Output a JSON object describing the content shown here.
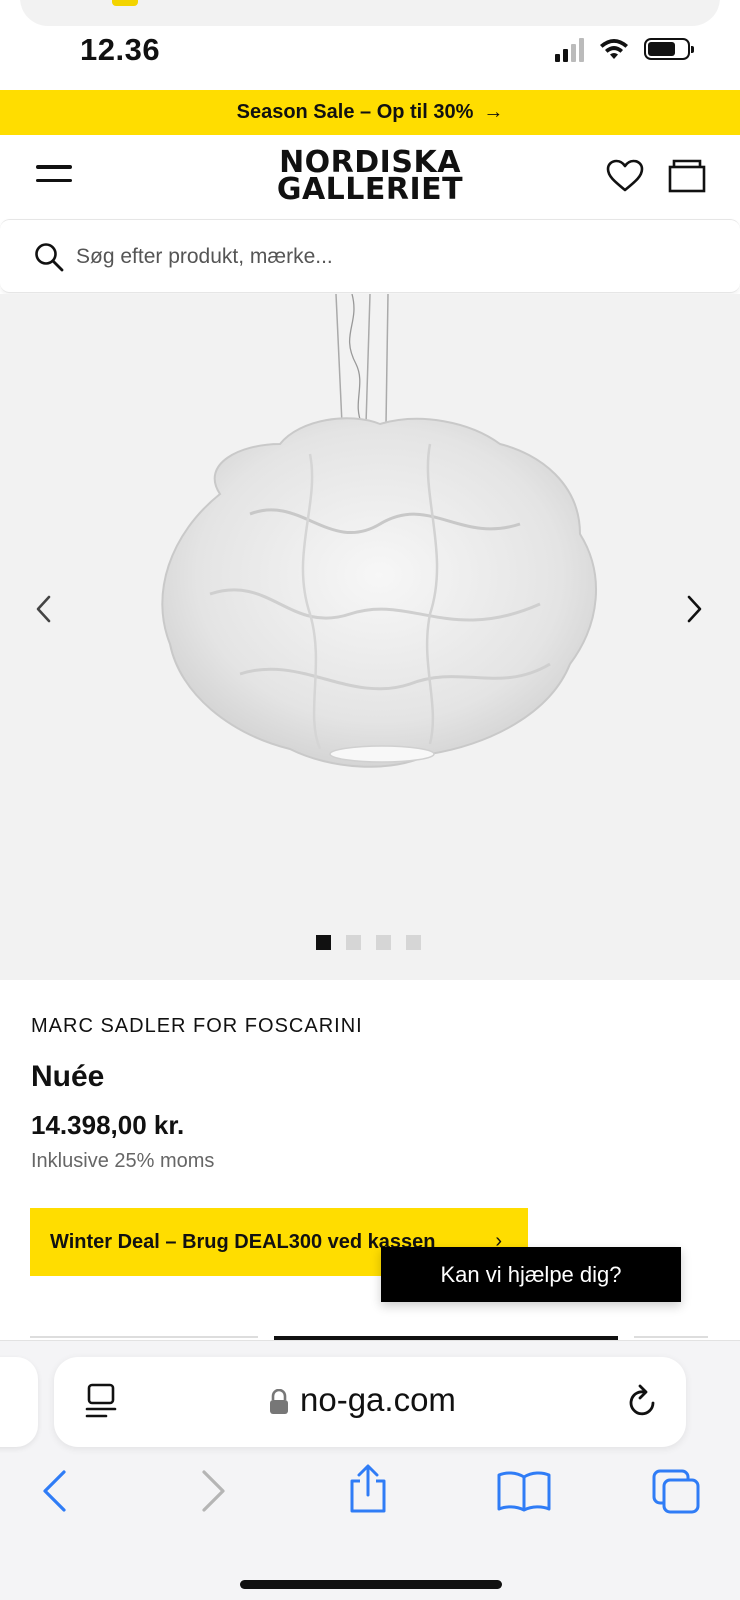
{
  "status_bar": {
    "time": "12.36"
  },
  "promo_bar": {
    "text": "Season Sale – Op til 30%",
    "arrow": "→"
  },
  "header": {
    "logo_line1": "NORDISKA",
    "logo_line2": "GALLERIET"
  },
  "search": {
    "placeholder": "Søg efter produkt, mærke..."
  },
  "gallery": {
    "image_count": 4,
    "active_index": 0
  },
  "product": {
    "brand": "MARC SADLER FOR FOSCARINI",
    "name": "Nuée",
    "price": "14.398,00 kr.",
    "vat_note": "Inklusive 25% moms"
  },
  "deal_banner": {
    "text": "Winter Deal – Brug DEAL300 ved kassen",
    "chevron": "›"
  },
  "chat_button": {
    "label": "Kan vi hjælpe dig?"
  },
  "browser": {
    "url": "no-ga.com"
  },
  "colors": {
    "accent_yellow": "#ffdd00",
    "black": "#000000",
    "gallery_bg": "#f2f2f2",
    "ios_blue": "#2f7cf6"
  },
  "icons": [
    "menu-icon",
    "heart-icon",
    "shopping-bag-icon",
    "search-icon",
    "chevron-left-icon",
    "chevron-right-icon",
    "reader-icon",
    "lock-icon",
    "reload-icon",
    "back-icon",
    "forward-icon",
    "share-icon",
    "bookmarks-icon",
    "tabs-icon"
  ]
}
